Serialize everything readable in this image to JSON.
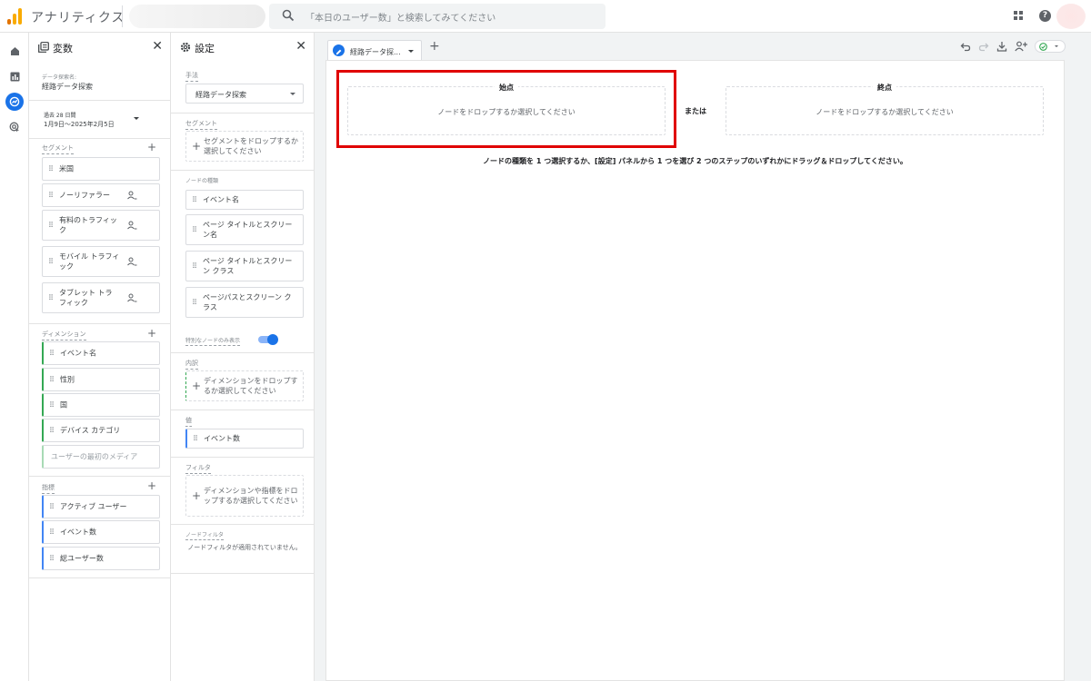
{
  "header": {
    "app_title": "アナリティクス",
    "search_placeholder": "「本日のユーザー数」と検索してみてください",
    "help_glyph": "?",
    "colors": {
      "logo_orange": "#f9ab00",
      "logo_dark": "#e37400",
      "accent": "#1a73e8"
    }
  },
  "rail": {
    "items": [
      {
        "icon": "home-icon"
      },
      {
        "icon": "reports-icon"
      },
      {
        "icon": "explore-icon",
        "active": true
      },
      {
        "icon": "advertising-icon"
      }
    ]
  },
  "variables": {
    "title": "変数",
    "close": "✕",
    "exploration_name_label": "データ探索名:",
    "exploration_name": "経路データ探索",
    "date_range_label": "過去 28 日間",
    "date_range": "1月9日～2025年2月5日",
    "segments_label": "セグメント",
    "segments": [
      "米国",
      "ノーリファラー",
      "有料のトラフィック",
      "モバイル トラフィック",
      "タブレット トラフィック"
    ],
    "dimensions_label": "ディメンション",
    "dimensions": [
      "イベント名",
      "性別",
      "国",
      "デバイス カテゴリ"
    ],
    "dimension_placeholder": "ユーザーの最初のメディア",
    "metrics_label": "指標",
    "metrics": [
      "アクティブ ユーザー",
      "イベント数",
      "総ユーザー数"
    ],
    "plus": "+"
  },
  "settings": {
    "title": "設定",
    "close": "✕",
    "technique_label": "手法",
    "technique_value": "経路データ探索",
    "segment_label": "セグメント",
    "segment_drop": "セグメントをドロップするか選択してください",
    "node_type_label": "ノードの種類",
    "node_types": [
      "イベント名",
      "ページ タイトルとスクリーン名",
      "ページ タイトルとスクリーン クラス",
      "ページパスとスクリーン クラス"
    ],
    "unique_nodes_label": "特別なノードのみ表示",
    "unique_nodes_on": true,
    "breakdown_label": "内訳",
    "breakdown_drop": "ディメンションをドロップするか選択してください",
    "values_label": "値",
    "values_item": "イベント数",
    "filters_label": "フィルタ",
    "filters_drop": "ディメンションや指標をドロップするか選択してください",
    "node_filter_label": "ノードフィルタ",
    "node_filter_text": "ノードフィルタが適用されていません。",
    "plus": "+"
  },
  "canvas": {
    "tab_label": "経路データ探...",
    "tab_add": "+",
    "start_title": "始点",
    "end_title": "終点",
    "node_drop_text": "ノードをドロップするか選択してください",
    "or_text": "または",
    "hint": "ノードの種類を 1 つ選択するか、[設定] パネルから 1 つを選び 2 つのステップのいずれかにドラッグ＆ドロップしてください。",
    "toolbar": [
      "undo-icon",
      "redo-icon",
      "download-icon",
      "share-icon",
      "status-check-icon"
    ],
    "highlight_color": "#e00000"
  }
}
